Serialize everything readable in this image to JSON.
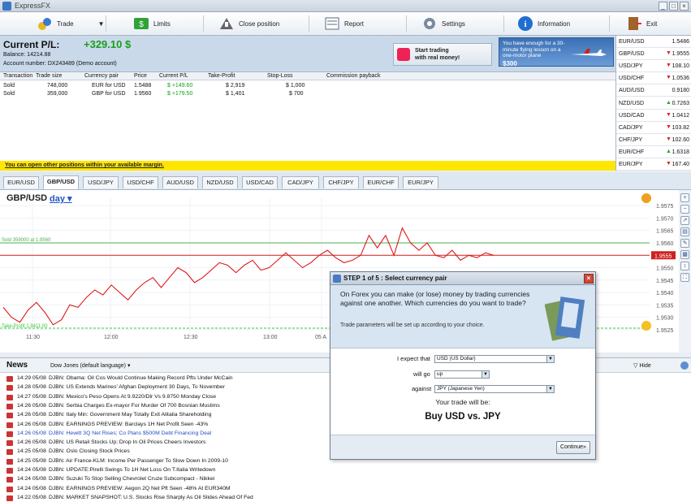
{
  "window": {
    "title": "ExpressFX"
  },
  "toolbar": {
    "items": [
      {
        "label": "Trade",
        "icon": "trade-icon"
      },
      {
        "label": "Limits",
        "icon": "limits-icon"
      },
      {
        "label": "Close position",
        "icon": "close-position-icon"
      },
      {
        "label": "Report",
        "icon": "report-icon"
      },
      {
        "label": "Settings",
        "icon": "settings-icon"
      },
      {
        "label": "Information",
        "icon": "information-icon"
      },
      {
        "label": "Exit",
        "icon": "exit-icon"
      }
    ]
  },
  "summary": {
    "pl_label": "Current P/L:",
    "pl_value": "+329.10 $",
    "balance": "Balance: 14214.88",
    "account": "Account number: DX243489 (Demo account)"
  },
  "ads": {
    "real_money": "Start trading\nwith real money!",
    "lesson": "You have enough for a 30-minute flying lesson on a one-motor plane",
    "lesson_price": "$300"
  },
  "positions": {
    "headers": [
      "Transaction",
      "Trade size",
      "Currency pair",
      "Price",
      "Current P/L",
      "Take-Profit",
      "Stop-Loss",
      "Commission payback"
    ],
    "rows": [
      [
        "Sold",
        "748,000",
        "EUR for USD",
        "1.5488",
        "$ +149.60",
        "$ 2,919",
        "$ 1,000",
        ""
      ],
      [
        "Sold",
        "359,000",
        "GBP for USD",
        "1.9560",
        "$ +179.50",
        "$ 1,401",
        "$ 700",
        ""
      ]
    ],
    "margin_note": "You can open other positions within your available margin."
  },
  "quotes": [
    {
      "symbol": "EUR/USD",
      "value": "1.5486",
      "dir": ""
    },
    {
      "symbol": "GBP/USD",
      "value": "1.9555",
      "dir": "down"
    },
    {
      "symbol": "USD/JPY",
      "value": "108.10",
      "dir": "down"
    },
    {
      "symbol": "USD/CHF",
      "value": "1.0536",
      "dir": "down"
    },
    {
      "symbol": "AUD/USD",
      "value": "0.9180",
      "dir": ""
    },
    {
      "symbol": "NZD/USD",
      "value": "0.7263",
      "dir": "up"
    },
    {
      "symbol": "USD/CAD",
      "value": "1.0412",
      "dir": "down"
    },
    {
      "symbol": "CAD/JPY",
      "value": "103.82",
      "dir": "down"
    },
    {
      "symbol": "CHF/JPY",
      "value": "102.60",
      "dir": "down"
    },
    {
      "symbol": "EUR/CHF",
      "value": "1.6318",
      "dir": "up"
    },
    {
      "symbol": "EUR/JPY",
      "value": "167.40",
      "dir": "down"
    }
  ],
  "tabs": [
    "EUR/USD",
    "GBP/USD",
    "USD/JPY",
    "USD/CHF",
    "AUD/USD",
    "NZD/USD",
    "USD/CAD",
    "CAD/JPY",
    "CHF/JPY",
    "EUR/CHF",
    "EUR/JPY"
  ],
  "active_tab": "GBP/USD",
  "chart": {
    "pair": "GBP/USD",
    "timeframe": "day",
    "current_price": "1.9555",
    "sold_line_label": "Sold 359000 at 1.9560",
    "take_profit_label": "Take-Profit 1.9411.00",
    "x_ticks": [
      "11:30",
      "12:00",
      "12:30",
      "13:00",
      "05 A"
    ],
    "y_ticks": [
      "1.9575",
      "1.9570",
      "1.9565",
      "1.9560",
      "1.9555",
      "1.9550",
      "1.9545",
      "1.9540",
      "1.9535",
      "1.9530",
      "1.9525"
    ],
    "colors": {
      "price": "#e01818",
      "sold": "#4caf50",
      "take_profit": "#3cc43c",
      "current": "#d02020"
    }
  },
  "chart_data": {
    "type": "line",
    "title": "GBP/USD",
    "ylim": [
      1.9523,
      1.9578
    ],
    "series": [
      {
        "values": [
          1.9534,
          1.953,
          1.9528,
          1.9533,
          1.9536,
          1.9532,
          1.9527,
          1.9529,
          1.9535,
          1.9534,
          1.9538,
          1.9541,
          1.9539,
          1.9543,
          1.954,
          1.9537,
          1.9541,
          1.9544,
          1.9546,
          1.9542,
          1.9546,
          1.955,
          1.9548,
          1.9544,
          1.9546,
          1.9549,
          1.9552,
          1.9551,
          1.9548,
          1.9551,
          1.9553,
          1.9549,
          1.955,
          1.9553,
          1.9556,
          1.9553,
          1.955,
          1.9552,
          1.9555,
          1.9557,
          1.9554,
          1.9552,
          1.9553,
          1.9555,
          1.9563,
          1.9558,
          1.9563,
          1.9555,
          1.9566,
          1.956,
          1.9557,
          1.956,
          1.9555,
          1.9554,
          1.9557,
          1.9553,
          1.9555,
          1.9554,
          1.9556,
          1.9555
        ]
      }
    ]
  },
  "side_tools": [
    "zoom-in-icon",
    "zoom-out-icon",
    "arrow-icon",
    "chart-type-icon",
    "drawing-icon",
    "print-icon",
    "scroll-icon",
    "fullscreen-icon"
  ],
  "news": {
    "title": "News",
    "source": "Dow Jones (default language)",
    "hide": "Hide",
    "items": [
      {
        "time": "14:29 05/08",
        "text": "DJBN: Obama: Oil Cos Would Continue Making Record Pfts Under McCain",
        "link": false
      },
      {
        "time": "14:28 05/08",
        "text": "DJBN: US Extends Marines' Afghan Deployment 30 Days, To November",
        "link": false
      },
      {
        "time": "14:27 05/08",
        "text": "DJBN: Mexico's Peso Opens At 9.9220/Dlr Vs 9.8750 Monday Close",
        "link": false
      },
      {
        "time": "14:26 05/08",
        "text": "DJBN: Serbia Charges Ex-mayor For Murder Of 700 Bosnian Muslims",
        "link": false
      },
      {
        "time": "14:26 05/08",
        "text": "DJBN: Italy Min: Government May Totally Exit Alitalia Shareholding",
        "link": false
      },
      {
        "time": "14:26 05/08",
        "text": "DJBN: EARNINGS PREVIEW: Barclays 1H Net Profit Seen -43%",
        "link": false
      },
      {
        "time": "14:26 05/08",
        "text": "DJBN: Hewitt 3Q Net Rises; Co Plans $500M Debt Financing Deal",
        "link": true
      },
      {
        "time": "14:26 05/08",
        "text": "DJBN: US Retail Stocks Up; Drop In Oil Prices Cheers Investors",
        "link": false
      },
      {
        "time": "14:25 05/08",
        "text": "DJBN: Oslo Closing Stock Prices",
        "link": false
      },
      {
        "time": "14:25 05/08",
        "text": "DJBN: Air France-KLM: Income Per Passenger To Slow Down In 2009-10",
        "link": false
      },
      {
        "time": "14:24 05/08",
        "text": "DJBN: UPDATE:Pirelli Swings To 1H Net Loss On T.Italia Writedown",
        "link": false
      },
      {
        "time": "14:24 05/08",
        "text": "DJBN: Suzuki To Stop Selling Chevrolet Cruze Subcompact - Nikkei",
        "link": false
      },
      {
        "time": "14:24 05/08",
        "text": "DJBN: EARNINGS PREVIEW: Aegon 2Q Net Pft Seen -48% At EUR340M",
        "link": false
      },
      {
        "time": "14:22 05/08",
        "text": "DJBN: MARKET SNAPSHOT: U.S. Stocks Rise Sharply As Oil Slides Ahead Of Fed",
        "link": false
      }
    ]
  },
  "dialog": {
    "title": "STEP 1 of 5 : Select currency pair",
    "intro": "On Forex you can make (or lose) money by trading currencies against one another. Which currencies do you want to trade?",
    "sub": "Trade parameters will be set up according to your choice.",
    "expect_label": "I expect that",
    "expect_value": "USD (US Dollar)",
    "will_go_label": "will go",
    "will_go_value": "up",
    "against_label": "against",
    "against_value": "JPY (Japanese Yen)",
    "result_label": "Your trade will be:",
    "result": "Buy USD vs. JPY",
    "continue": "Continue»"
  }
}
